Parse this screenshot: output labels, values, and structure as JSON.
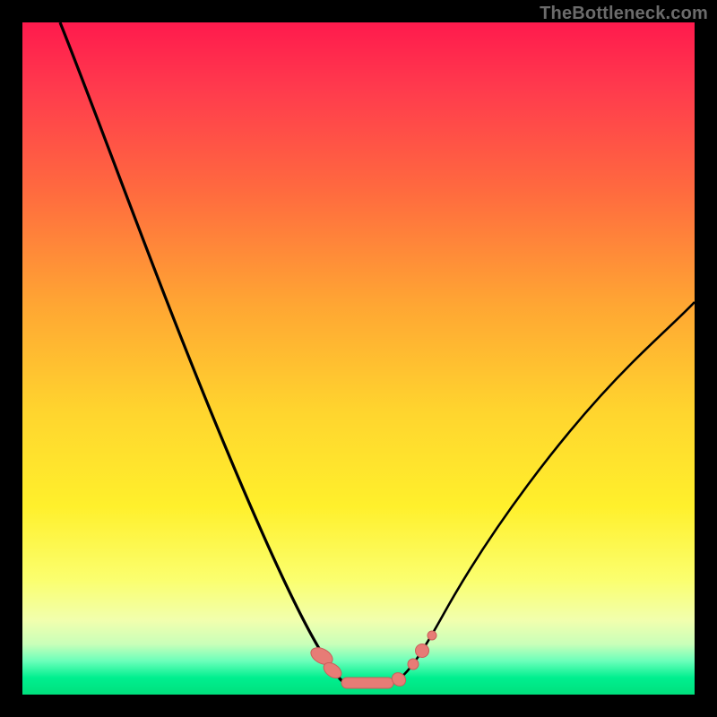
{
  "watermark": {
    "text": "TheBottleneck.com"
  },
  "colors": {
    "curve_stroke": "#000000",
    "marker_fill": "#e77c76",
    "marker_stroke": "#c95f5a",
    "gradient_top": "#ff1a4d",
    "gradient_bottom": "#00e07d",
    "background": "#000000"
  },
  "chart_data": {
    "type": "line",
    "title": "",
    "xlabel": "",
    "ylabel": "",
    "xlim": [
      0,
      100
    ],
    "ylim": [
      0,
      100
    ],
    "series": [
      {
        "name": "left-curve",
        "x": [
          0,
          2,
          5,
          8,
          12,
          16,
          20,
          24,
          28,
          32,
          36,
          40,
          43,
          45,
          46.5,
          47.5
        ],
        "y": [
          100,
          95,
          88,
          81,
          72,
          63,
          54,
          45.5,
          37,
          29,
          21.5,
          14.5,
          9,
          5.5,
          3,
          1.5
        ]
      },
      {
        "name": "right-curve",
        "x": [
          57,
          58,
          60,
          63,
          67,
          72,
          78,
          84,
          90,
          96,
          100
        ],
        "y": [
          1.5,
          3,
          6,
          11,
          18,
          26,
          34.5,
          42,
          49,
          55,
          59
        ]
      },
      {
        "name": "flat-bottom",
        "x": [
          47.5,
          50,
          52.5,
          55,
          57
        ],
        "y": [
          1.5,
          1,
          1,
          1,
          1.5
        ]
      },
      {
        "name": "markers",
        "x_values": [
          44.5,
          46,
          49,
          52,
          55,
          57.3,
          59.2,
          60.8
        ],
        "y_values": [
          5.5,
          3,
          1.5,
          1.2,
          1.5,
          2,
          5,
          8
        ]
      }
    ]
  }
}
